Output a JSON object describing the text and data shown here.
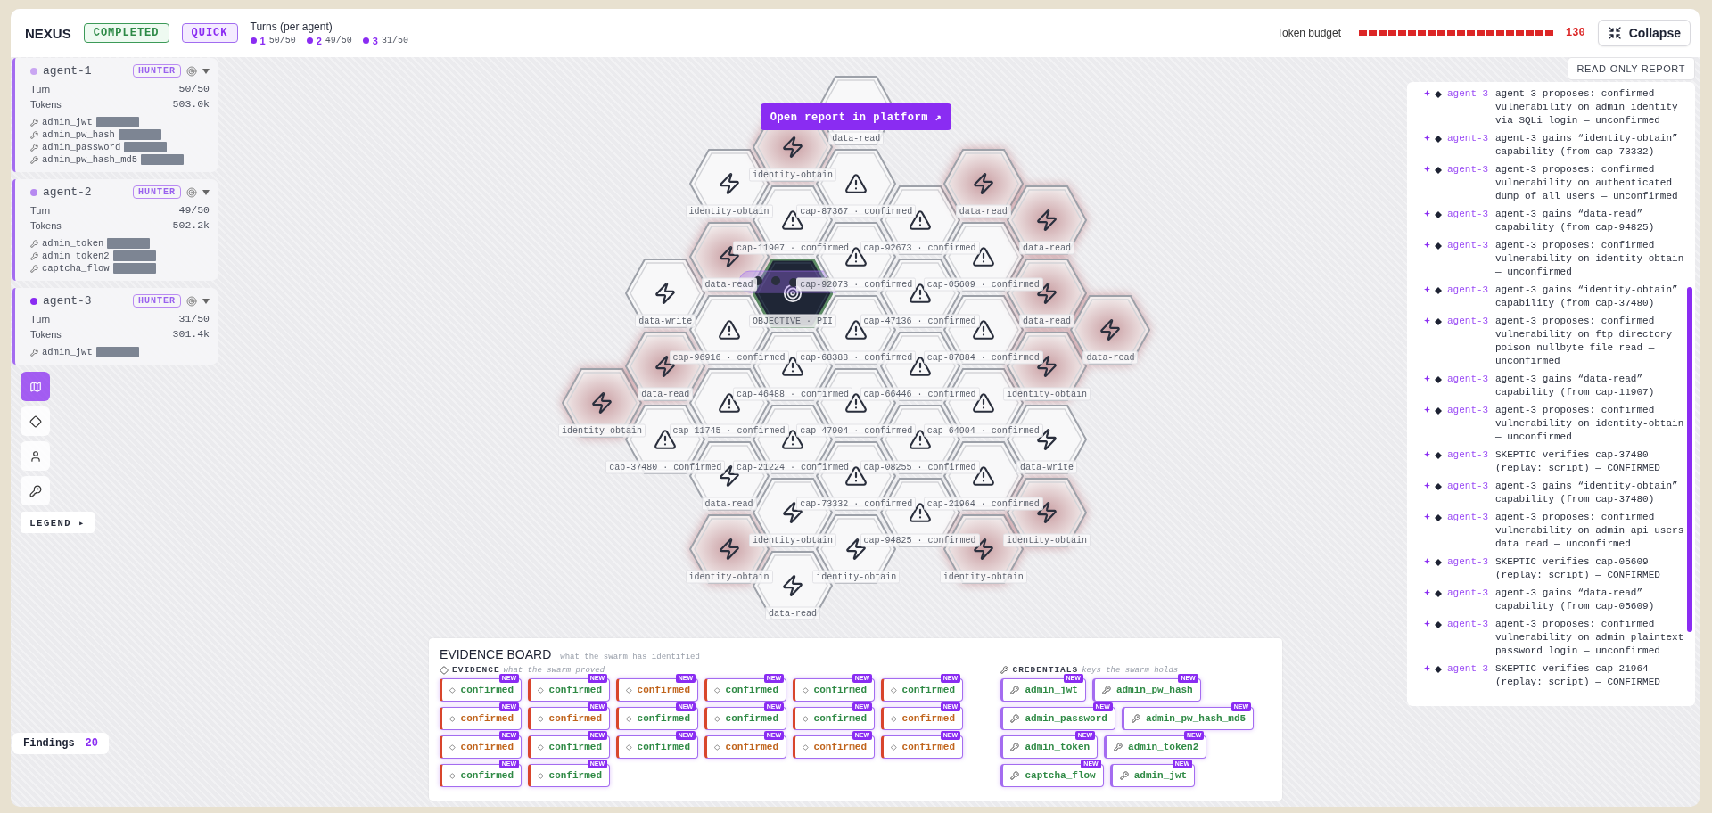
{
  "header": {
    "title": "NEXUS",
    "status": "COMPLETED",
    "mode": "QUICK",
    "turns_label": "Turns (per agent)",
    "turns": [
      {
        "agent": "1",
        "reading": "50/50"
      },
      {
        "agent": "2",
        "reading": "49/50"
      },
      {
        "agent": "3",
        "reading": "31/50"
      }
    ],
    "budget_label": "Token budget",
    "budget": {
      "level": 1,
      "reading": "130"
    },
    "collapse_button": "Collapse"
  },
  "agents": [
    {
      "name": "agent-1",
      "color": "#c9a6f2",
      "role": "HUNTER",
      "turn_label": "Turn",
      "turn": "50/50",
      "tokens_label": "Tokens",
      "tokens": "503.0k",
      "credentials": [
        "admin_jwt",
        "admin_pw_hash",
        "admin_password",
        "admin_pw_hash_md5"
      ]
    },
    {
      "name": "agent-2",
      "color": "#b689f0",
      "role": "HUNTER",
      "turn_label": "Turn",
      "turn": "49/50",
      "tokens_label": "Tokens",
      "tokens": "502.2k",
      "credentials": [
        "admin_token",
        "admin_token2",
        "captcha_flow"
      ]
    },
    {
      "name": "agent-3",
      "color": "#8a2cf2",
      "role": "HUNTER",
      "turn_label": "Turn",
      "turn": "31/50",
      "tokens_label": "Tokens",
      "tokens": "301.4k",
      "credentials": [
        "admin_jwt"
      ]
    }
  ],
  "view_toolbar": [
    {
      "kind": "map",
      "selected": true
    },
    {
      "kind": "diamond",
      "selected": false
    },
    {
      "kind": "user",
      "selected": false
    },
    {
      "kind": "key",
      "selected": false
    }
  ],
  "legend_button": "LEGEND ▸",
  "findings": {
    "label": "Findings",
    "count": "20"
  },
  "graph": {
    "report_button": "Open report in platform ↗",
    "columns": [
      [
        {
          "kind": "empty"
        },
        {
          "kind": "empty"
        },
        {
          "kind": "empty"
        },
        {
          "kind": "empty"
        },
        {
          "kind": "bolt",
          "highlighted": true,
          "label": "identity-obtain"
        }
      ],
      [
        {
          "kind": "empty"
        },
        {
          "kind": "empty"
        },
        {
          "kind": "bolt",
          "highlighted": false,
          "label": "data-write"
        },
        {
          "kind": "bolt",
          "highlighted": true,
          "label": "data-read"
        },
        {
          "kind": "warning",
          "highlighted": false,
          "label": "cap-37480 · confirmed"
        }
      ],
      [
        {
          "kind": "empty"
        },
        {
          "kind": "bolt",
          "highlighted": false,
          "label": "identity-obtain"
        },
        {
          "kind": "bolt",
          "highlighted": true,
          "label": "data-read"
        },
        {
          "kind": "warning",
          "highlighted": false,
          "label": "cap-96916 · confirmed"
        },
        {
          "kind": "warning",
          "highlighted": false,
          "label": "cap-11745 · confirmed"
        },
        {
          "kind": "bolt",
          "highlighted": false,
          "label": "data-read"
        },
        {
          "kind": "bolt",
          "highlighted": true,
          "label": "identity-obtain"
        }
      ],
      [
        {
          "kind": "bolt",
          "highlighted": true,
          "label": "identity-obtain"
        },
        {
          "kind": "warning",
          "highlighted": false,
          "label": "cap-11907 · confirmed"
        },
        {
          "kind": "objective",
          "highlighted": false,
          "label": "OBJECTIVE · PII"
        },
        {
          "kind": "warning",
          "highlighted": false,
          "label": "cap-46488 · confirmed"
        },
        {
          "kind": "warning",
          "highlighted": false,
          "label": "cap-21224 · confirmed"
        },
        {
          "kind": "bolt",
          "highlighted": false,
          "label": "identity-obtain"
        },
        {
          "kind": "bolt",
          "highlighted": false,
          "label": "data-read"
        }
      ],
      [
        {
          "kind": "blank",
          "highlighted": false,
          "label": "data-read"
        },
        {
          "kind": "warning",
          "highlighted": false,
          "label": "cap-87367 · confirmed"
        },
        {
          "kind": "warning",
          "highlighted": false,
          "label": "cap-92073 · confirmed"
        },
        {
          "kind": "warning",
          "highlighted": false,
          "label": "cap-68388 · confirmed"
        },
        {
          "kind": "warning",
          "highlighted": false,
          "label": "cap-47904 · confirmed"
        },
        {
          "kind": "warning",
          "highlighted": false,
          "label": "cap-73332 · confirmed"
        },
        {
          "kind": "bolt",
          "highlighted": false,
          "label": "identity-obtain"
        }
      ],
      [
        {
          "kind": "empty"
        },
        {
          "kind": "warning",
          "highlighted": false,
          "label": "cap-92673 · confirmed"
        },
        {
          "kind": "warning",
          "highlighted": false,
          "label": "cap-47136 · confirmed"
        },
        {
          "kind": "warning",
          "highlighted": false,
          "label": "cap-66446 · confirmed"
        },
        {
          "kind": "warning",
          "highlighted": false,
          "label": "cap-08255 · confirmed"
        },
        {
          "kind": "warning",
          "highlighted": false,
          "label": "cap-94825 · confirmed"
        }
      ],
      [
        {
          "kind": "empty"
        },
        {
          "kind": "bolt",
          "highlighted": true,
          "label": "data-read"
        },
        {
          "kind": "warning",
          "highlighted": false,
          "label": "cap-05609 · confirmed"
        },
        {
          "kind": "warning",
          "highlighted": false,
          "label": "cap-87884 · confirmed"
        },
        {
          "kind": "warning",
          "highlighted": false,
          "label": "cap-64904 · confirmed"
        },
        {
          "kind": "warning",
          "highlighted": false,
          "label": "cap-21964 · confirmed"
        },
        {
          "kind": "bolt",
          "highlighted": true,
          "label": "identity-obtain"
        }
      ],
      [
        {
          "kind": "empty"
        },
        {
          "kind": "bolt",
          "highlighted": true,
          "label": "data-read"
        },
        {
          "kind": "bolt",
          "highlighted": true,
          "label": "data-read"
        },
        {
          "kind": "bolt",
          "highlighted": true,
          "label": "identity-obtain"
        },
        {
          "kind": "bolt",
          "highlighted": false,
          "label": "data-write"
        },
        {
          "kind": "bolt",
          "highlighted": true,
          "label": "identity-obtain"
        }
      ],
      [
        {
          "kind": "empty"
        },
        {
          "kind": "empty"
        },
        {
          "kind": "empty"
        },
        {
          "kind": "bolt",
          "highlighted": true,
          "label": "data-read"
        }
      ]
    ]
  },
  "evidence_board": {
    "title": "EVIDENCE BOARD",
    "subtitle": "what the swarm has identified",
    "evidence": {
      "title": "EVIDENCE",
      "subtitle": "what the swarm proved",
      "items": [
        {
          "label": "confirmed",
          "color": "#2f8a45",
          "badge": "NEW"
        },
        {
          "label": "confirmed",
          "color": "#2f8a45",
          "badge": "NEW"
        },
        {
          "label": "confirmed",
          "color": "#c0641c",
          "badge": "NEW"
        },
        {
          "label": "confirmed",
          "color": "#2f8a45",
          "badge": "NEW"
        },
        {
          "label": "confirmed",
          "color": "#2f8a45",
          "badge": "NEW"
        },
        {
          "label": "confirmed",
          "color": "#2f8a45",
          "badge": "NEW"
        },
        {
          "label": "confirmed",
          "color": "#c0641c",
          "badge": "NEW"
        },
        {
          "label": "confirmed",
          "color": "#c0641c",
          "badge": "NEW"
        },
        {
          "label": "confirmed",
          "color": "#2f8a45",
          "badge": "NEW"
        },
        {
          "label": "confirmed",
          "color": "#2f8a45",
          "badge": "NEW"
        },
        {
          "label": "confirmed",
          "color": "#2f8a45",
          "badge": "NEW"
        },
        {
          "label": "confirmed",
          "color": "#c0641c",
          "badge": "NEW"
        },
        {
          "label": "confirmed",
          "color": "#c0641c",
          "badge": "NEW"
        },
        {
          "label": "confirmed",
          "color": "#2f8a45",
          "badge": "NEW"
        },
        {
          "label": "confirmed",
          "color": "#2f8a45",
          "badge": "NEW"
        },
        {
          "label": "confirmed",
          "color": "#c0641c",
          "badge": "NEW"
        },
        {
          "label": "confirmed",
          "color": "#c0641c",
          "badge": "NEW"
        },
        {
          "label": "confirmed",
          "color": "#c0641c",
          "badge": "NEW"
        },
        {
          "label": "confirmed",
          "color": "#2f8a45",
          "badge": "NEW"
        },
        {
          "label": "confirmed",
          "color": "#2f8a45",
          "badge": "NEW"
        }
      ]
    },
    "credentials": {
      "title": "CREDENTIALS",
      "subtitle": "keys the swarm holds",
      "items": [
        {
          "label": "admin_jwt",
          "badge": "NEW"
        },
        {
          "label": "admin_pw_hash",
          "badge": "NEW"
        },
        {
          "label": "admin_password",
          "badge": "NEW"
        },
        {
          "label": "admin_pw_hash_md5",
          "badge": "NEW"
        },
        {
          "label": "admin_token",
          "badge": "NEW"
        },
        {
          "label": "admin_token2",
          "badge": "NEW"
        },
        {
          "label": "captcha_flow",
          "badge": "NEW"
        },
        {
          "label": "admin_jwt",
          "badge": "NEW"
        }
      ]
    }
  },
  "log": {
    "readonly_button": "READ-ONLY REPORT",
    "entries": [
      {
        "agent": "agent-3",
        "text": "agent-3 proposes: confirmed vulnerability on admin identity via SQLi login — unconfirmed"
      },
      {
        "agent": "agent-3",
        "text": "agent-3 gains “identity-obtain” capability (from cap-73332)"
      },
      {
        "agent": "agent-3",
        "text": "agent-3 proposes: confirmed vulnerability on authenticated dump of all users — unconfirmed"
      },
      {
        "agent": "agent-3",
        "text": "agent-3 gains “data-read” capability (from cap-94825)"
      },
      {
        "agent": "agent-3",
        "text": "agent-3 proposes: confirmed vulnerability on identity-obtain — unconfirmed"
      },
      {
        "agent": "agent-3",
        "text": "agent-3 gains “identity-obtain” capability (from cap-37480)"
      },
      {
        "agent": "agent-3",
        "text": "agent-3 proposes: confirmed vulnerability on ftp directory poison nullbyte file read — unconfirmed"
      },
      {
        "agent": "agent-3",
        "text": "agent-3 gains “data-read” capability (from cap-11907)"
      },
      {
        "agent": "agent-3",
        "text": "agent-3 proposes: confirmed vulnerability on identity-obtain — unconfirmed"
      },
      {
        "agent": "agent-3",
        "text": "SKEPTIC verifies cap-37480 (replay: script) — CONFIRMED"
      },
      {
        "agent": "agent-3",
        "text": "agent-3 gains “identity-obtain” capability (from cap-37480)"
      },
      {
        "agent": "agent-3",
        "text": "agent-3 proposes: confirmed vulnerability on admin api users data read — unconfirmed"
      },
      {
        "agent": "agent-3",
        "text": "SKEPTIC verifies cap-05609 (replay: script) — CONFIRMED"
      },
      {
        "agent": "agent-3",
        "text": "agent-3 gains “data-read” capability (from cap-05609)"
      },
      {
        "agent": "agent-3",
        "text": "agent-3 proposes: confirmed vulnerability on admin plaintext password login — unconfirmed"
      },
      {
        "agent": "agent-3",
        "text": "SKEPTIC verifies cap-21964 (replay: script) — CONFIRMED"
      }
    ]
  }
}
